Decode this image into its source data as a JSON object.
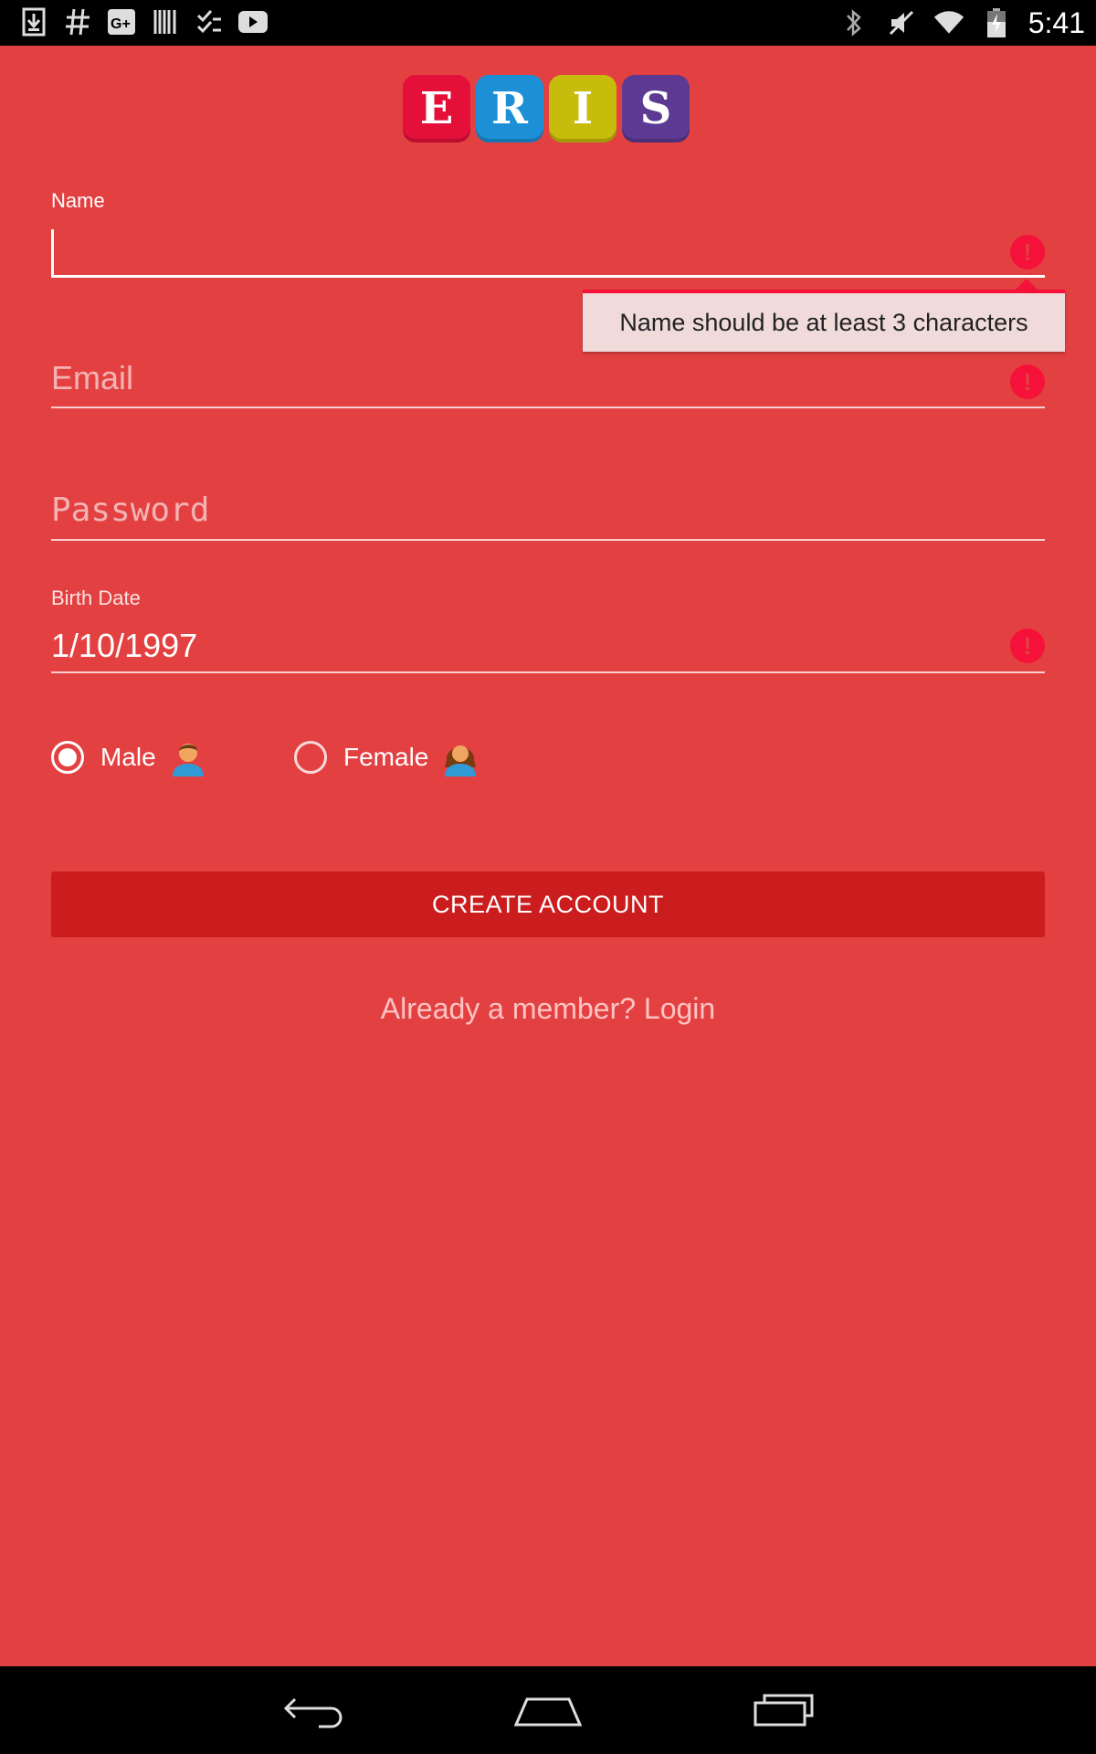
{
  "status_bar": {
    "time": "5:41",
    "left_icons": [
      "download-icon",
      "hash-icon",
      "google-plus-icon",
      "barcode-icon",
      "checklist-icon",
      "youtube-icon"
    ],
    "right_icons": [
      "bluetooth-icon",
      "mute-icon",
      "wifi-icon",
      "battery-charging-icon"
    ]
  },
  "logo": {
    "letters": [
      {
        "char": "E",
        "color": "#e4103a"
      },
      {
        "char": "R",
        "color": "#1c8fd6"
      },
      {
        "char": "I",
        "color": "#c7bb0b"
      },
      {
        "char": "S",
        "color": "#5c3a93"
      }
    ]
  },
  "form": {
    "name": {
      "label": "Name",
      "value": "",
      "error": "Name should be at least 3 characters"
    },
    "email": {
      "placeholder": "Email"
    },
    "password": {
      "placeholder": "Password"
    },
    "birth_date": {
      "label": "Birth Date",
      "value": "1/10/1997"
    },
    "gender": {
      "options": [
        {
          "label": "Male",
          "checked": true
        },
        {
          "label": "Female",
          "checked": false
        }
      ]
    },
    "submit_label": "CREATE ACCOUNT",
    "login_link": "Already a member? Login"
  },
  "colors": {
    "background": "#e34141",
    "button": "#cb1c1e",
    "error": "#f4123a",
    "link": "#ffc3c3"
  },
  "nav_bar": {
    "buttons": [
      "back-icon",
      "home-icon",
      "recents-icon"
    ]
  }
}
